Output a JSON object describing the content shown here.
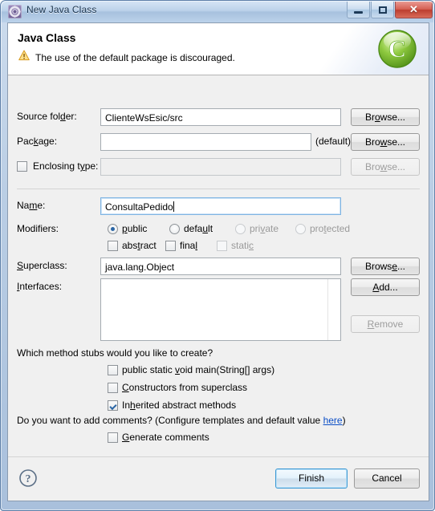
{
  "window": {
    "title": "New Java Class",
    "icon": "java-class-wizard-icon",
    "controls": {
      "minimize": "minimize-button",
      "maximize": "restore-button",
      "close_glyph": "✕"
    }
  },
  "header": {
    "title": "Java Class",
    "message": "The use of the default package is discouraged.",
    "warning_icon": "warning-triangle-icon",
    "logo": "java-class-green-c-icon"
  },
  "form": {
    "source_folder": {
      "label_pre": "Source fol",
      "label_mn": "d",
      "label_post": "er:",
      "value": "ClienteWsEsic/src",
      "button": "Browse...",
      "button_mn": "o",
      "button_pre": "Br",
      "button_post": "wse..."
    },
    "package": {
      "label_pre": "Pac",
      "label_mn": "k",
      "label_post": "age:",
      "value": "",
      "suffix": "(default)",
      "button_pre": "Bro",
      "button_mn": "w",
      "button_post": "se..."
    },
    "enclosing_type": {
      "label_pre": "Enclosing t",
      "label_mn": "y",
      "label_post": "pe:",
      "checked": false,
      "value": "",
      "button_pre": "Bro",
      "button_mn": "w",
      "button_post": "se...",
      "disabled": true
    },
    "name": {
      "label_pre": "Na",
      "label_mn": "m",
      "label_post": "e:",
      "value": "ConsultaPedido",
      "focused": true
    },
    "modifiers": {
      "label": "Modifiers:",
      "radios": [
        {
          "pre": "",
          "mn": "p",
          "post": "ublic",
          "selected": true,
          "disabled": false
        },
        {
          "pre": "defa",
          "mn": "u",
          "post": "lt",
          "selected": false,
          "disabled": false
        },
        {
          "pre": "pri",
          "mn": "v",
          "post": "ate",
          "selected": false,
          "disabled": true
        },
        {
          "pre": "pro",
          "mn": "t",
          "post": "ected",
          "selected": false,
          "disabled": true
        }
      ],
      "checkboxes": [
        {
          "pre": "abs",
          "mn": "t",
          "post": "ract",
          "checked": false,
          "disabled": false
        },
        {
          "pre": "fina",
          "mn": "l",
          "post": "",
          "checked": false,
          "disabled": false
        },
        {
          "pre": "stati",
          "mn": "c",
          "post": "",
          "checked": false,
          "disabled": true
        }
      ]
    },
    "superclass": {
      "label_pre": "",
      "label_mn": "S",
      "label_post": "uperclass:",
      "value": "java.lang.Object",
      "button_pre": "Brows",
      "button_mn": "e",
      "button_post": "..."
    },
    "interfaces": {
      "label_pre": "",
      "label_mn": "I",
      "label_post": "nterfaces:",
      "items": [],
      "add_pre": "",
      "add_mn": "A",
      "add_post": "dd...",
      "remove_pre": "",
      "remove_mn": "R",
      "remove_post": "emove",
      "remove_disabled": true
    },
    "method_stubs": {
      "question": "Which method stubs would you like to create?",
      "options": [
        {
          "pre": "public static ",
          "mn": "v",
          "post": "oid main(String[] args)",
          "checked": false
        },
        {
          "pre": "",
          "mn": "C",
          "post": "onstructors from superclass",
          "checked": false
        },
        {
          "pre": "In",
          "mn": "h",
          "post": "erited abstract methods",
          "checked": true
        }
      ]
    },
    "comments": {
      "question_pre": "Do you want to add comments? (Configure templates and default value ",
      "link": "here",
      "question_post": ")",
      "checkbox": {
        "pre": "",
        "mn": "G",
        "post": "enerate comments",
        "checked": false
      }
    }
  },
  "footer": {
    "help_icon": "help-question-icon",
    "finish_label": "Finish",
    "cancel_label": "Cancel"
  },
  "colors": {
    "accent": "#3c99d4",
    "link": "#0b4ec6",
    "logo_green": "#7ac943",
    "warning": "#f0ad26",
    "close_red": "#bc3d2e"
  }
}
